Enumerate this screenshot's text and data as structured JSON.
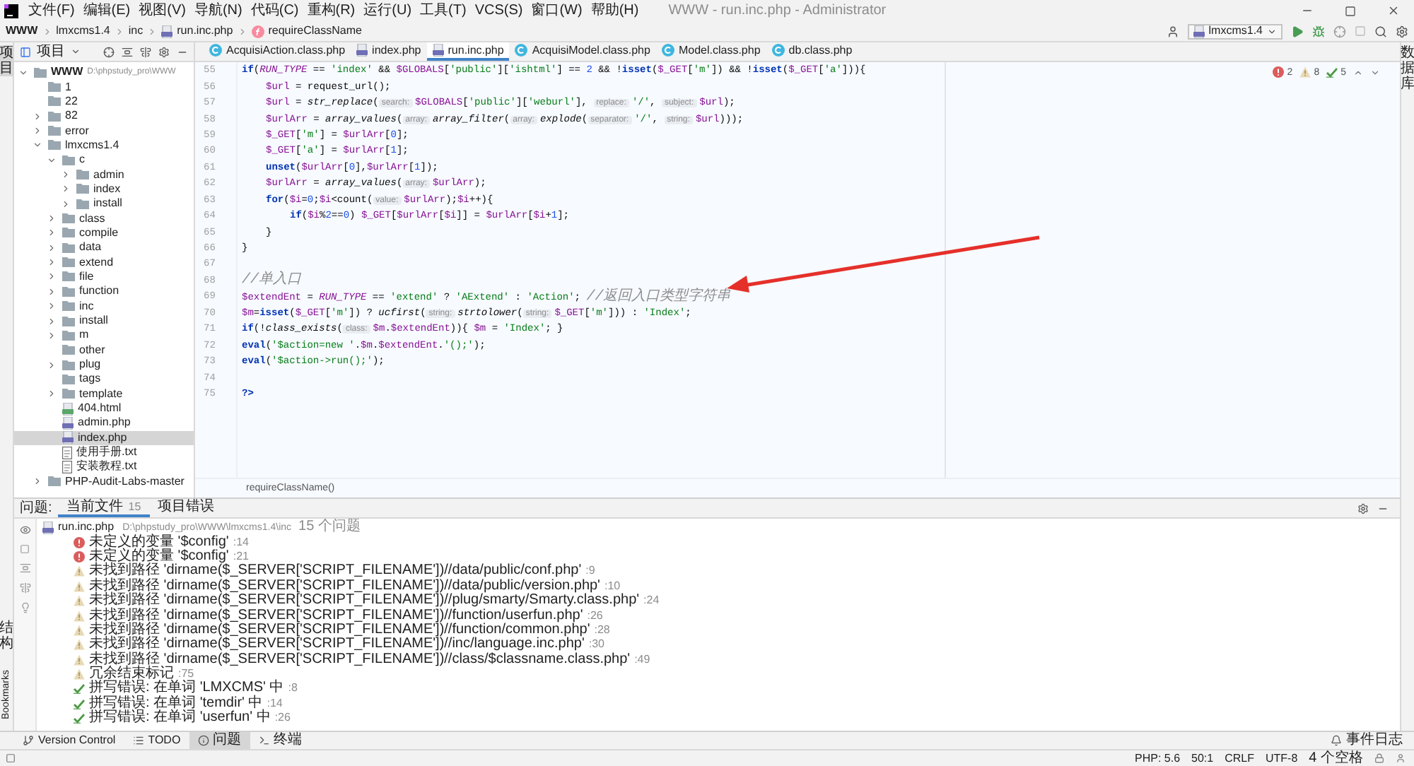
{
  "menu": [
    "文件(F)",
    "编辑(E)",
    "视图(V)",
    "导航(N)",
    "代码(C)",
    "重构(R)",
    "运行(U)",
    "工具(T)",
    "VCS(S)",
    "窗口(W)",
    "帮助(H)"
  ],
  "window": {
    "title": "WWW - run.inc.php - Administrator"
  },
  "breadcrumb": [
    {
      "label": "WWW",
      "kind": "project"
    },
    {
      "label": "lmxcms1.4",
      "kind": "folder"
    },
    {
      "label": "inc",
      "kind": "folder"
    },
    {
      "label": "run.inc.php",
      "kind": "php"
    },
    {
      "label": "requireClassName",
      "kind": "function"
    }
  ],
  "run_config": "lmxcms1.4",
  "left_strip": {
    "top": "项目",
    "bottom": [
      "结构",
      "Bookmarks"
    ]
  },
  "right_strip": "数据库",
  "project_pane": {
    "title": "项目"
  },
  "tabs": [
    {
      "label": "AcquisiAction.class.php",
      "kind": "class",
      "selected": false
    },
    {
      "label": "index.php",
      "kind": "php",
      "selected": false
    },
    {
      "label": "run.inc.php",
      "kind": "php",
      "selected": true
    },
    {
      "label": "AcquisiModel.class.php",
      "kind": "class",
      "selected": false
    },
    {
      "label": "Model.class.php",
      "kind": "class",
      "selected": false
    },
    {
      "label": "db.class.php",
      "kind": "class",
      "selected": false
    }
  ],
  "tree": [
    {
      "label": "WWW",
      "path": "D:\\phpstudy_pro\\WWW",
      "kind": "folder",
      "expanded": true,
      "selected": false,
      "children": [
        {
          "label": "1",
          "kind": "folder",
          "selected": false
        },
        {
          "label": "22",
          "kind": "folder",
          "selected": false
        },
        {
          "label": "82",
          "kind": "folder",
          "expanded": false,
          "selected": false
        },
        {
          "label": "error",
          "kind": "folder",
          "expanded": false,
          "selected": false
        },
        {
          "label": "lmxcms1.4",
          "kind": "folder",
          "expanded": true,
          "selected": false,
          "children": [
            {
              "label": "c",
              "kind": "folder",
              "expanded": true,
              "selected": false,
              "children": [
                {
                  "label": "admin",
                  "kind": "folder",
                  "expanded": false,
                  "selected": false
                },
                {
                  "label": "index",
                  "kind": "folder",
                  "expanded": false,
                  "selected": false
                },
                {
                  "label": "install",
                  "kind": "folder",
                  "expanded": false,
                  "selected": false
                }
              ]
            },
            {
              "label": "class",
              "kind": "folder",
              "expanded": false,
              "selected": false
            },
            {
              "label": "compile",
              "kind": "folder",
              "expanded": false,
              "selected": false
            },
            {
              "label": "data",
              "kind": "folder",
              "expanded": false,
              "selected": false
            },
            {
              "label": "extend",
              "kind": "folder",
              "expanded": false,
              "selected": false
            },
            {
              "label": "file",
              "kind": "folder",
              "expanded": false,
              "selected": false
            },
            {
              "label": "function",
              "kind": "folder",
              "expanded": false,
              "selected": false
            },
            {
              "label": "inc",
              "kind": "folder",
              "expanded": false,
              "selected": false
            },
            {
              "label": "install",
              "kind": "folder",
              "expanded": false,
              "selected": false
            },
            {
              "label": "m",
              "kind": "folder",
              "expanded": false,
              "selected": false
            },
            {
              "label": "other",
              "kind": "folder",
              "selected": false
            },
            {
              "label": "plug",
              "kind": "folder",
              "expanded": false,
              "selected": false
            },
            {
              "label": "tags",
              "kind": "folder",
              "selected": false
            },
            {
              "label": "template",
              "kind": "folder",
              "expanded": false,
              "selected": false
            },
            {
              "label": "404.html",
              "kind": "html",
              "selected": false
            },
            {
              "label": "admin.php",
              "kind": "php",
              "selected": false
            },
            {
              "label": "index.php",
              "kind": "php",
              "selected": true
            },
            {
              "label": "使用手册.txt",
              "kind": "txt",
              "selected": false
            },
            {
              "label": "安装教程.txt",
              "kind": "txt",
              "selected": false
            }
          ]
        },
        {
          "label": "PHP-Audit-Labs-master",
          "kind": "folder",
          "expanded": false,
          "selected": false
        }
      ]
    }
  ],
  "inspection": {
    "errors": "2",
    "warnings": "8",
    "typos": "5"
  },
  "code": [
    {
      "number": "55",
      "kind": "top",
      "tokens": [
        {
          "kind": "kw",
          "text": "if"
        },
        {
          "kind": "p",
          "text": "("
        },
        {
          "kind": "c",
          "text": "RUN_TYPE"
        },
        {
          "kind": "p",
          "text": " == "
        },
        {
          "kind": "s",
          "text": "'index'"
        },
        {
          "kind": "p",
          "text": " && "
        },
        {
          "kind": "v",
          "text": "$GLOBALS"
        },
        {
          "kind": "p",
          "text": "["
        },
        {
          "kind": "s",
          "text": "'public'"
        },
        {
          "kind": "p",
          "text": "]["
        },
        {
          "kind": "s",
          "text": "'ishtml'"
        },
        {
          "kind": "p",
          "text": "] == "
        },
        {
          "kind": "n",
          "text": "2"
        },
        {
          "kind": "p",
          "text": " && !"
        },
        {
          "kind": "kw",
          "text": "isset"
        },
        {
          "kind": "p",
          "text": "("
        },
        {
          "kind": "v",
          "text": "$_GET"
        },
        {
          "kind": "p",
          "text": "["
        },
        {
          "kind": "s",
          "text": "'m'"
        },
        {
          "kind": "p",
          "text": "]) && !"
        },
        {
          "kind": "kw",
          "text": "isset"
        },
        {
          "kind": "p",
          "text": "("
        },
        {
          "kind": "v",
          "text": "$_GET"
        },
        {
          "kind": "p",
          "text": "["
        },
        {
          "kind": "s",
          "text": "'a'"
        },
        {
          "kind": "p",
          "text": "])){"
        }
      ]
    },
    {
      "number": "56",
      "kind": "block",
      "tokens": [
        {
          "kind": "v",
          "text": "$url"
        },
        {
          "kind": "p",
          "text": " = request_url();"
        }
      ]
    },
    {
      "number": "57",
      "kind": "block",
      "tokens": [
        {
          "kind": "v",
          "text": "$url"
        },
        {
          "kind": "p",
          "text": " = "
        },
        {
          "kind": "f",
          "text": "str_replace"
        },
        {
          "kind": "p",
          "text": "("
        },
        {
          "kind": "h",
          "text": "search:"
        },
        {
          "kind": "v",
          "text": "$GLOBALS"
        },
        {
          "kind": "p",
          "text": "["
        },
        {
          "kind": "s",
          "text": "'public'"
        },
        {
          "kind": "p",
          "text": "]["
        },
        {
          "kind": "s",
          "text": "'weburl'"
        },
        {
          "kind": "p",
          "text": "], "
        },
        {
          "kind": "h",
          "text": "replace:"
        },
        {
          "kind": "s",
          "text": "'/'"
        },
        {
          "kind": "p",
          "text": ", "
        },
        {
          "kind": "h",
          "text": "subject:"
        },
        {
          "kind": "v",
          "text": "$url"
        },
        {
          "kind": "p",
          "text": ");"
        }
      ]
    },
    {
      "number": "58",
      "kind": "block",
      "tokens": [
        {
          "kind": "v",
          "text": "$urlArr"
        },
        {
          "kind": "p",
          "text": " = "
        },
        {
          "kind": "f",
          "text": "array_values"
        },
        {
          "kind": "p",
          "text": "("
        },
        {
          "kind": "h",
          "text": "array:"
        },
        {
          "kind": "f",
          "text": "array_filter"
        },
        {
          "kind": "p",
          "text": "("
        },
        {
          "kind": "h",
          "text": "array:"
        },
        {
          "kind": "f",
          "text": "explode"
        },
        {
          "kind": "p",
          "text": "("
        },
        {
          "kind": "h",
          "text": "separator:"
        },
        {
          "kind": "s",
          "text": "'/'"
        },
        {
          "kind": "p",
          "text": ", "
        },
        {
          "kind": "h",
          "text": "string:"
        },
        {
          "kind": "v",
          "text": "$url"
        },
        {
          "kind": "p",
          "text": ")));"
        }
      ]
    },
    {
      "number": "59",
      "kind": "block",
      "tokens": [
        {
          "kind": "v",
          "text": "$_GET"
        },
        {
          "kind": "p",
          "text": "["
        },
        {
          "kind": "s",
          "text": "'m'"
        },
        {
          "kind": "p",
          "text": "] = "
        },
        {
          "kind": "v",
          "text": "$urlArr"
        },
        {
          "kind": "p",
          "text": "["
        },
        {
          "kind": "n",
          "text": "0"
        },
        {
          "kind": "p",
          "text": "];"
        }
      ]
    },
    {
      "number": "60",
      "kind": "block",
      "tokens": [
        {
          "kind": "v",
          "text": "$_GET"
        },
        {
          "kind": "p",
          "text": "["
        },
        {
          "kind": "s",
          "text": "'a'"
        },
        {
          "kind": "p",
          "text": "] = "
        },
        {
          "kind": "v",
          "text": "$urlArr"
        },
        {
          "kind": "p",
          "text": "["
        },
        {
          "kind": "n",
          "text": "1"
        },
        {
          "kind": "p",
          "text": "];"
        }
      ]
    },
    {
      "number": "61",
      "kind": "block",
      "tokens": [
        {
          "kind": "kw",
          "text": "unset"
        },
        {
          "kind": "p",
          "text": "("
        },
        {
          "kind": "v",
          "text": "$urlArr"
        },
        {
          "kind": "p",
          "text": "["
        },
        {
          "kind": "n",
          "text": "0"
        },
        {
          "kind": "p",
          "text": "],"
        },
        {
          "kind": "v",
          "text": "$urlArr"
        },
        {
          "kind": "p",
          "text": "["
        },
        {
          "kind": "n",
          "text": "1"
        },
        {
          "kind": "p",
          "text": "]);"
        }
      ]
    },
    {
      "number": "62",
      "kind": "block",
      "tokens": [
        {
          "kind": "v",
          "text": "$urlArr"
        },
        {
          "kind": "p",
          "text": " = "
        },
        {
          "kind": "f",
          "text": "array_values"
        },
        {
          "kind": "p",
          "text": "("
        },
        {
          "kind": "h",
          "text": "array:"
        },
        {
          "kind": "v",
          "text": "$urlArr"
        },
        {
          "kind": "p",
          "text": ");"
        }
      ]
    },
    {
      "number": "63",
      "kind": "block",
      "tokens": [
        {
          "kind": "kw",
          "text": "for"
        },
        {
          "kind": "p",
          "text": "("
        },
        {
          "kind": "v",
          "text": "$i"
        },
        {
          "kind": "p",
          "text": "="
        },
        {
          "kind": "n",
          "text": "0"
        },
        {
          "kind": "p",
          "text": ";"
        },
        {
          "kind": "v",
          "text": "$i"
        },
        {
          "kind": "p",
          "text": "<count("
        },
        {
          "kind": "h",
          "text": "value:"
        },
        {
          "kind": "v",
          "text": "$urlArr"
        },
        {
          "kind": "p",
          "text": ");"
        },
        {
          "kind": "v",
          "text": "$i"
        },
        {
          "kind": "p",
          "text": "++){"
        }
      ]
    },
    {
      "number": "64",
      "kind": "inner",
      "tokens": [
        {
          "kind": "kw",
          "text": "if"
        },
        {
          "kind": "p",
          "text": "("
        },
        {
          "kind": "v",
          "text": "$i"
        },
        {
          "kind": "p",
          "text": "%"
        },
        {
          "kind": "n",
          "text": "2"
        },
        {
          "kind": "p",
          "text": "=="
        },
        {
          "kind": "n",
          "text": "0"
        },
        {
          "kind": "p",
          "text": ") "
        },
        {
          "kind": "v",
          "text": "$_GET"
        },
        {
          "kind": "p",
          "text": "["
        },
        {
          "kind": "v",
          "text": "$urlArr"
        },
        {
          "kind": "p",
          "text": "["
        },
        {
          "kind": "v",
          "text": "$i"
        },
        {
          "kind": "p",
          "text": "]] = "
        },
        {
          "kind": "v",
          "text": "$urlArr"
        },
        {
          "kind": "p",
          "text": "["
        },
        {
          "kind": "v",
          "text": "$i"
        },
        {
          "kind": "p",
          "text": "+"
        },
        {
          "kind": "n",
          "text": "1"
        },
        {
          "kind": "p",
          "text": "];"
        }
      ]
    },
    {
      "number": "65",
      "kind": "block",
      "tokens": [
        {
          "kind": "p",
          "text": "}"
        }
      ]
    },
    {
      "number": "66",
      "kind": "top",
      "tokens": [
        {
          "kind": "p",
          "text": "}"
        }
      ]
    },
    {
      "number": "67"
    },
    {
      "number": "68",
      "kind": "top",
      "tokens": [
        {
          "kind": "cm",
          "text": "//单入口"
        }
      ]
    },
    {
      "number": "69",
      "kind": "top",
      "tokens": [
        {
          "kind": "v",
          "text": "$extendEnt"
        },
        {
          "kind": "p",
          "text": " = "
        },
        {
          "kind": "c",
          "text": "RUN_TYPE"
        },
        {
          "kind": "p",
          "text": " == "
        },
        {
          "kind": "s",
          "text": "'extend'"
        },
        {
          "kind": "p",
          "text": " ? "
        },
        {
          "kind": "s",
          "text": "'AExtend'"
        },
        {
          "kind": "p",
          "text": " : "
        },
        {
          "kind": "s",
          "text": "'Action'"
        },
        {
          "kind": "p",
          "text": "; "
        },
        {
          "kind": "cm",
          "text": "//返回入口类型字符串"
        }
      ]
    },
    {
      "number": "70",
      "kind": "top",
      "tokens": [
        {
          "kind": "v",
          "text": "$m"
        },
        {
          "kind": "p",
          "text": "="
        },
        {
          "kind": "kw",
          "text": "isset"
        },
        {
          "kind": "p",
          "text": "("
        },
        {
          "kind": "v",
          "text": "$_GET"
        },
        {
          "kind": "p",
          "text": "["
        },
        {
          "kind": "s",
          "text": "'m'"
        },
        {
          "kind": "p",
          "text": "]) ? "
        },
        {
          "kind": "f",
          "text": "ucfirst"
        },
        {
          "kind": "p",
          "text": "("
        },
        {
          "kind": "h",
          "text": "string:"
        },
        {
          "kind": "f",
          "text": "strtolower"
        },
        {
          "kind": "p",
          "text": "("
        },
        {
          "kind": "h",
          "text": "string:"
        },
        {
          "kind": "v",
          "text": "$_GET"
        },
        {
          "kind": "p",
          "text": "["
        },
        {
          "kind": "s",
          "text": "'m'"
        },
        {
          "kind": "p",
          "text": "])) : "
        },
        {
          "kind": "s",
          "text": "'Index'"
        },
        {
          "kind": "p",
          "text": ";"
        }
      ]
    },
    {
      "number": "71",
      "kind": "top",
      "tokens": [
        {
          "kind": "kw",
          "text": "if"
        },
        {
          "kind": "p",
          "text": "(!"
        },
        {
          "kind": "f",
          "text": "class_exists"
        },
        {
          "kind": "p",
          "text": "("
        },
        {
          "kind": "h",
          "text": "class:"
        },
        {
          "kind": "v",
          "text": "$m"
        },
        {
          "kind": "p",
          "text": "."
        },
        {
          "kind": "v",
          "text": "$extendEnt"
        },
        {
          "kind": "p",
          "text": ")){ "
        },
        {
          "kind": "v",
          "text": "$m"
        },
        {
          "kind": "p",
          "text": " = "
        },
        {
          "kind": "s",
          "text": "'Index'"
        },
        {
          "kind": "p",
          "text": "; }"
        }
      ]
    },
    {
      "number": "72",
      "kind": "top",
      "tokens": [
        {
          "kind": "kw",
          "text": "eval"
        },
        {
          "kind": "p",
          "text": "("
        },
        {
          "kind": "s",
          "text": "'$action=new '"
        },
        {
          "kind": "p",
          "text": "."
        },
        {
          "kind": "v",
          "text": "$m"
        },
        {
          "kind": "p",
          "text": "."
        },
        {
          "kind": "v",
          "text": "$extendEnt"
        },
        {
          "kind": "p",
          "text": "."
        },
        {
          "kind": "s",
          "text": "'();'"
        },
        {
          "kind": "p",
          "text": ");"
        }
      ]
    },
    {
      "number": "73",
      "kind": "top",
      "tokens": [
        {
          "kind": "kw",
          "text": "eval"
        },
        {
          "kind": "p",
          "text": "("
        },
        {
          "kind": "s",
          "text": "'$action->run();'"
        },
        {
          "kind": "p",
          "text": ");"
        }
      ]
    },
    {
      "number": "74"
    },
    {
      "number": "75",
      "kind": "top",
      "tokens": [
        {
          "kind": "kw",
          "text": "?>"
        }
      ]
    }
  ],
  "editor_breadcrumb": "requireClassName()",
  "problems": {
    "label": "问题:",
    "tabs": [
      {
        "label": "当前文件",
        "count": "15",
        "selected": true
      },
      {
        "label": "项目错误",
        "selected": false
      }
    ],
    "file": {
      "name": "run.inc.php",
      "path": "D:\\phpstudy_pro\\WWW\\lmxcms1.4\\inc",
      "summary": "15 个问题"
    },
    "items": [
      {
        "kind": "error",
        "text": "未定义的变量 '$config'",
        "line": ":14"
      },
      {
        "kind": "error",
        "text": "未定义的变量 '$config'",
        "line": ":21"
      },
      {
        "kind": "warning",
        "text": "未找到路径 'dirname($_SERVER['SCRIPT_FILENAME'])//data/public/conf.php'",
        "line": ":9"
      },
      {
        "kind": "warning",
        "text": "未找到路径 'dirname($_SERVER['SCRIPT_FILENAME'])//data/public/version.php'",
        "line": ":10"
      },
      {
        "kind": "warning",
        "text": "未找到路径 'dirname($_SERVER['SCRIPT_FILENAME'])//plug/smarty/Smarty.class.php'",
        "line": ":24"
      },
      {
        "kind": "warning",
        "text": "未找到路径 'dirname($_SERVER['SCRIPT_FILENAME'])//function/userfun.php'",
        "line": ":26"
      },
      {
        "kind": "warning",
        "text": "未找到路径 'dirname($_SERVER['SCRIPT_FILENAME'])//function/common.php'",
        "line": ":28"
      },
      {
        "kind": "warning",
        "text": "未找到路径 'dirname($_SERVER['SCRIPT_FILENAME'])//inc/language.inc.php'",
        "line": ":30"
      },
      {
        "kind": "warning",
        "text": "未找到路径 'dirname($_SERVER['SCRIPT_FILENAME'])//class/$classname.class.php'",
        "line": ":49"
      },
      {
        "kind": "warning",
        "text": "冗余结束标记",
        "line": ":75"
      },
      {
        "kind": "typo",
        "text": "拼写错误: 在单词 'LMXCMS' 中",
        "line": ":8"
      },
      {
        "kind": "typo",
        "text": "拼写错误: 在单词 'temdir' 中",
        "line": ":14"
      },
      {
        "kind": "typo",
        "text": "拼写错误: 在单词 'userfun' 中",
        "line": ":26"
      }
    ]
  },
  "tool_tabs": [
    {
      "label": "Version Control",
      "kind": "vcs",
      "selected": false
    },
    {
      "label": "TODO",
      "kind": "todo",
      "selected": false
    },
    {
      "label": "问题",
      "kind": "problems",
      "selected": true
    },
    {
      "label": "终端",
      "kind": "terminal",
      "selected": false
    }
  ],
  "event_log": "事件日志",
  "status": [
    "PHP: 5.6",
    "50:1",
    "CRLF",
    "UTF-8",
    "4 个空格"
  ]
}
